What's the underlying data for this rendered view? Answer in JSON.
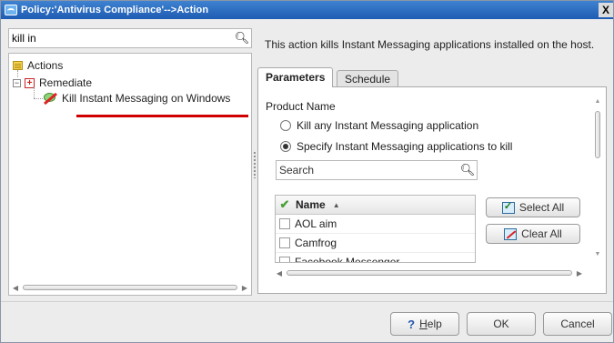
{
  "window": {
    "title": "Policy:'Antivirus Compliance'-->Action",
    "close_label": "X"
  },
  "left": {
    "search_value": "kill in",
    "tree": {
      "root": "Actions",
      "group": "Remediate",
      "expander": "−",
      "item": "Kill Instant Messaging on Windows"
    }
  },
  "right": {
    "description": "This action kills Instant Messaging applications installed on the host.",
    "tabs": [
      {
        "label": "Parameters"
      },
      {
        "label": "Schedule"
      }
    ],
    "product_name_label": "Product Name",
    "radio_options": [
      {
        "label": "Kill any Instant Messaging application",
        "selected": false
      },
      {
        "label": "Specify Instant Messaging applications to kill",
        "selected": true
      }
    ],
    "search_placeholder": "Search",
    "list": {
      "header_name": "Name",
      "rows": [
        "AOL aim",
        "Camfrog",
        "Facebook Messenger"
      ]
    },
    "select_all_label": "Select All",
    "clear_all_label": "Clear All"
  },
  "footer": {
    "help_first": "H",
    "help_rest": "elp",
    "help_icon": "?",
    "ok_label": "OK",
    "cancel_label": "Cancel"
  },
  "colors": {
    "title_bar": "#2a6cc0",
    "highlight_underline": "#d00000",
    "check": "#4aa03a"
  }
}
